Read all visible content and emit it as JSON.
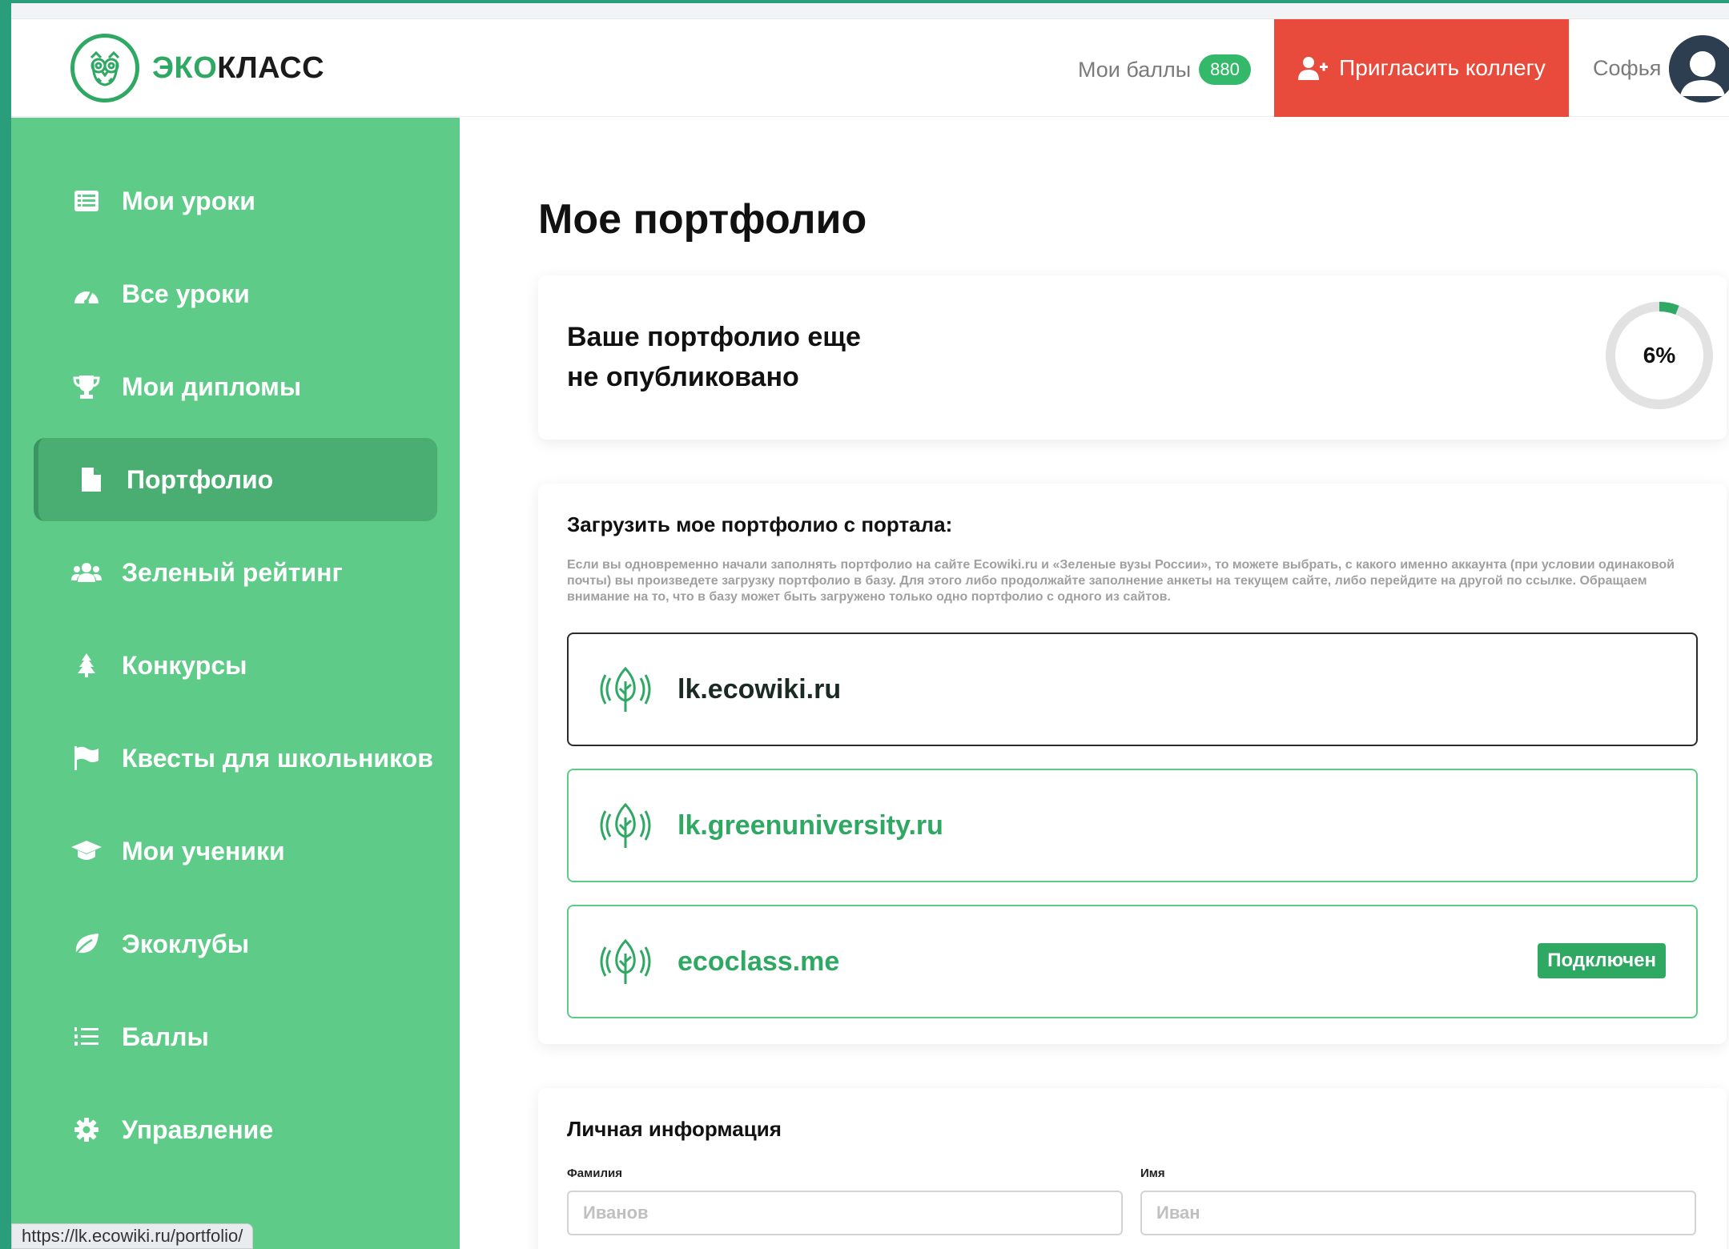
{
  "header": {
    "logo_eco": "ЭКО",
    "logo_rest": "КЛАСС",
    "points_label": "Мои баллы",
    "points_value": "880",
    "invite_label": "Пригласить коллегу",
    "username": "Софья"
  },
  "sidebar": {
    "items": [
      {
        "label": "Мои уроки",
        "icon": "list-icon"
      },
      {
        "label": "Все уроки",
        "icon": "dashboard-icon"
      },
      {
        "label": "Мои дипломы",
        "icon": "trophy-icon"
      },
      {
        "label": "Портфолио",
        "icon": "file-icon",
        "active": true
      },
      {
        "label": "Зеленый рейтинг",
        "icon": "users-icon"
      },
      {
        "label": "Конкурсы",
        "icon": "tree-icon"
      },
      {
        "label": "Квесты для школьников",
        "icon": "flag-icon"
      },
      {
        "label": "Мои ученики",
        "icon": "graduation-cap-icon"
      },
      {
        "label": "Экоклубы",
        "icon": "leaf-icon"
      },
      {
        "label": "Баллы",
        "icon": "list-ordered-icon"
      },
      {
        "label": "Управление",
        "icon": "gear-icon"
      }
    ]
  },
  "status_url": "https://lk.ecowiki.ru/portfolio/",
  "main": {
    "title": "Мое портфолио",
    "status": {
      "text_line1": "Ваше портфолио еще",
      "text_line2": "не опубликовано",
      "progress_label": "6%",
      "progress_value": 0.06
    },
    "import": {
      "title": "Загрузить мое портфолио с портала:",
      "description": "Если вы одновременно начали заполнять портфолио на сайте Ecowiki.ru и «Зеленые вузы России», то можете выбрать, с какого именно аккаунта (при условии одинаковой почты) вы произведете загрузку портфолио в базу. Для этого либо продолжайте заполнение анкеты на текущем сайте, либо перейдите на другой по ссылке. Обращаем внимание на то, что в базу может быть загружено только одно портфолио с одного из сайтов.",
      "portals": [
        {
          "name": "lk.ecowiki.ru",
          "style": "dark"
        },
        {
          "name": "lk.greenuniversity.ru",
          "style": "green"
        },
        {
          "name": "ecoclass.me",
          "style": "green",
          "badge": "Подключен"
        }
      ]
    },
    "personal": {
      "title": "Личная информация",
      "surname_label": "Фамилия",
      "surname_placeholder": "Иванов",
      "name_label": "Имя",
      "name_placeholder": "Иван"
    }
  },
  "colors": {
    "sidebar": "#5ecb88",
    "sidebar_active": "#4aae72",
    "brand_green": "#2ea863",
    "invite_red": "#e84a3c"
  }
}
